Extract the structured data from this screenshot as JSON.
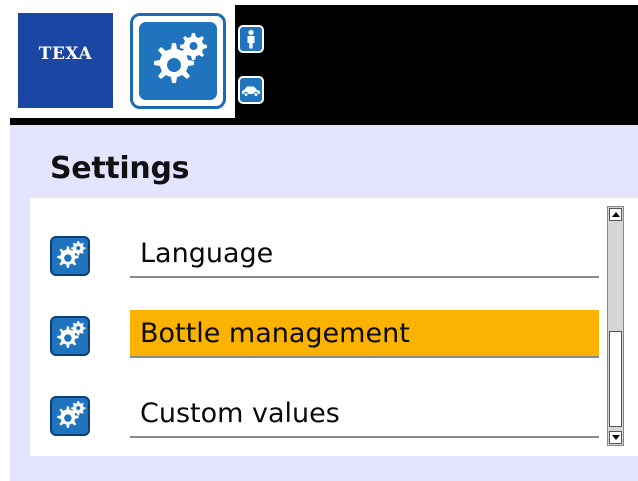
{
  "header": {
    "logo_text": "TEXA",
    "app_icon": "gears-icon",
    "side_icons": [
      "user-icon",
      "car-icon"
    ]
  },
  "page": {
    "title": "Settings"
  },
  "menu": {
    "items": [
      {
        "label": "Language",
        "icon": "gears-icon",
        "selected": false
      },
      {
        "label": "Bottle management",
        "icon": "gears-icon",
        "selected": true
      },
      {
        "label": "Custom values",
        "icon": "gears-icon",
        "selected": false
      }
    ]
  },
  "colors": {
    "brand_blue": "#1c46a3",
    "icon_blue": "#1f74bd",
    "selection": "#fcb200",
    "background": "#e5e4ff",
    "header_bar": "#000000"
  }
}
